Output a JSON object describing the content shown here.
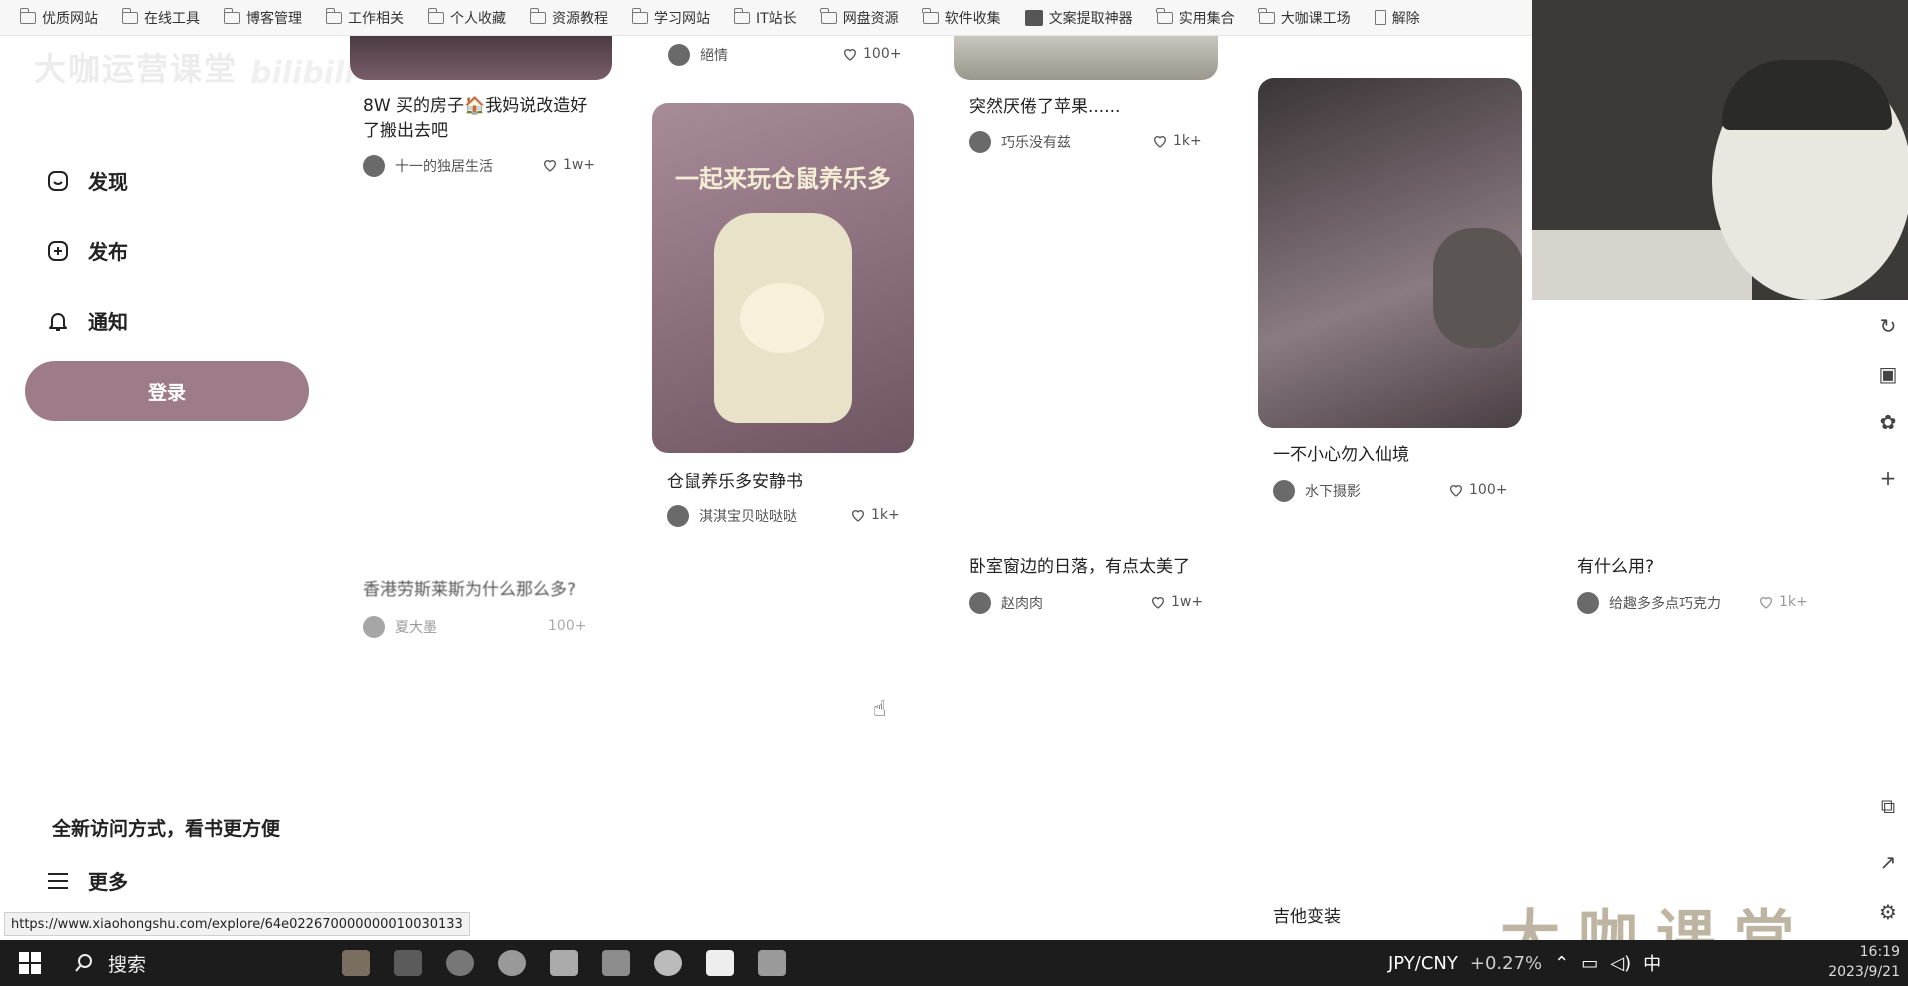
{
  "bookmarks": [
    {
      "label": "优质网站",
      "icon": "folder-icon"
    },
    {
      "label": "在线工具",
      "icon": "folder-icon"
    },
    {
      "label": "博客管理",
      "icon": "folder-icon"
    },
    {
      "label": "工作相关",
      "icon": "folder-icon"
    },
    {
      "label": "个人收藏",
      "icon": "folder-icon"
    },
    {
      "label": "资源教程",
      "icon": "folder-icon"
    },
    {
      "label": "学习网站",
      "icon": "folder-icon"
    },
    {
      "label": "IT站长",
      "icon": "folder-icon"
    },
    {
      "label": "网盘资源",
      "icon": "folder-icon"
    },
    {
      "label": "软件收集",
      "icon": "folder-icon"
    },
    {
      "label": "文案提取神器",
      "icon": "app-icon"
    },
    {
      "label": "实用集合",
      "icon": "folder-icon"
    },
    {
      "label": "大咖课工场",
      "icon": "folder-icon"
    },
    {
      "label": "解除",
      "icon": "document-icon"
    }
  ],
  "sidebar": {
    "brand_left": "大咖运营课堂",
    "brand_right": "bilibili",
    "nav": [
      {
        "label": "发现",
        "icon": "home-icon"
      },
      {
        "label": "发布",
        "icon": "plus-square-icon"
      },
      {
        "label": "通知",
        "icon": "bell-icon"
      }
    ],
    "login_label": "登录",
    "promo_text": "全新访问方式，看书更方便",
    "more_label": "更多"
  },
  "feed": {
    "cards": [
      {
        "title_lines": [
          "8W 买的房子🏠我妈说改造好",
          "了搬出去吧"
        ],
        "author": "十一的独居生活",
        "likes": "1w+"
      },
      {
        "top_author": "絕情",
        "top_likes": "100+"
      },
      {
        "title_lines": [
          "突然厌倦了苹果......"
        ],
        "author": "巧乐没有兹",
        "likes": "1k+"
      },
      {
        "image_text": "一起来玩仓鼠养乐多",
        "title_lines": [
          "仓鼠养乐多安静书"
        ],
        "author": "淇淇宝贝哒哒哒",
        "likes": "1k+"
      },
      {
        "title_lines": [
          "一不小心勿入仙境"
        ],
        "author": "水下摄影",
        "likes": "100+"
      },
      {
        "title_lines": [
          "香港劳斯莱斯为什么那么多?"
        ],
        "author": "夏大墨",
        "likes": "100+"
      },
      {
        "title_lines": [
          "卧室窗边的日落，有点太美了"
        ],
        "author": "赵肉肉",
        "likes": "1w+"
      },
      {
        "title_lines": [
          "有什么用?"
        ],
        "author": "给趣多多点巧克力",
        "likes": "1k+"
      },
      {
        "title_lines": [
          "吉他变装"
        ]
      }
    ]
  },
  "status_url": "https://www.xiaohongshu.com/explore/64e022670000000010030133",
  "watermark": "大咖课堂",
  "taskbar": {
    "search_label": "搜索",
    "currency": "JPY/CNY",
    "change": "+0.27%",
    "ime": "中",
    "time": "16:19",
    "date": "2023/9/21"
  }
}
